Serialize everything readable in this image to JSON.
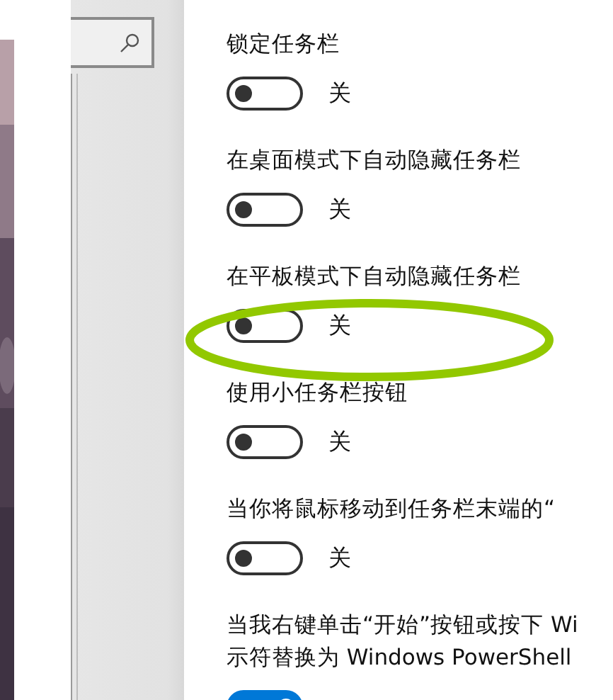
{
  "settings": [
    {
      "label": "锁定任务栏",
      "on": false,
      "state_text": "关"
    },
    {
      "label": "在桌面模式下自动隐藏任务栏",
      "on": false,
      "state_text": "关"
    },
    {
      "label": "在平板模式下自动隐藏任务栏",
      "on": false,
      "state_text": "关",
      "highlighted": true
    },
    {
      "label": "使用小任务栏按钮",
      "on": false,
      "state_text": "关"
    },
    {
      "label": "当你将鼠标移动到任务栏末端的“",
      "on": false,
      "state_text": "关"
    },
    {
      "label": "当我右键单击“开始”按钮或按下 Wi\n示符替换为 Windows PowerShell",
      "on": true
    }
  ]
}
